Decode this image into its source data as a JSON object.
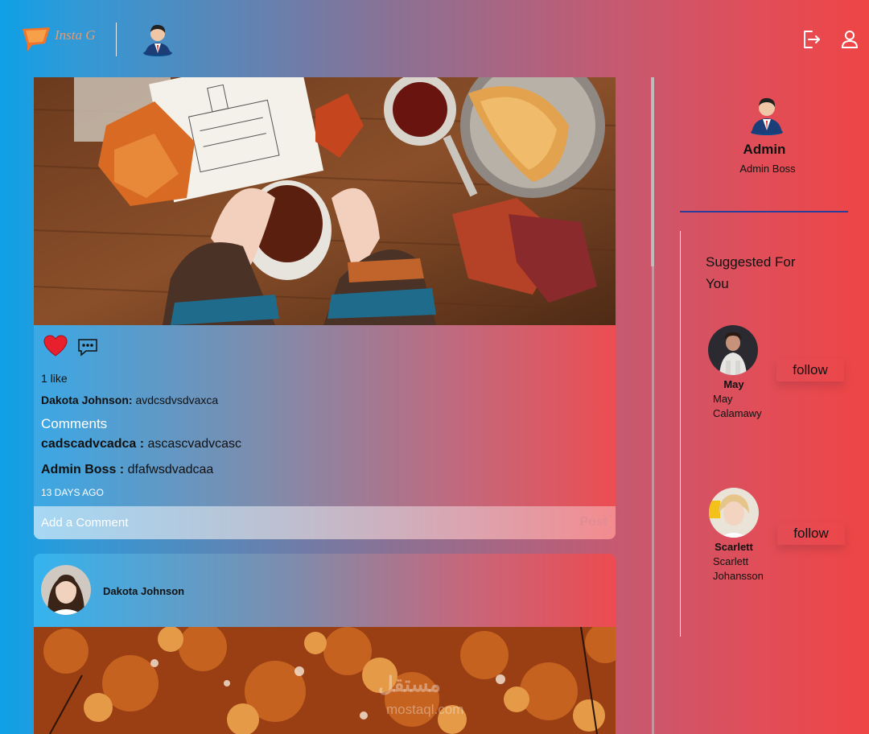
{
  "app": {
    "logo_text": "Insta G",
    "logo_tagline": "· · · · · · · · · ·"
  },
  "feed": {
    "post1": {
      "likes": "1 like",
      "author": "Dakota Johnson:",
      "caption": "avdcsdvsdvaxca",
      "comments_heading": "Comments",
      "comments": [
        {
          "user": "cadscadvcadca :",
          "text": "ascascvadvcasc"
        },
        {
          "user": "Admin Boss :",
          "text": "dfafwsdvadcaa"
        }
      ],
      "timestamp": "13 DAYS AGO",
      "add_comment_placeholder": "Add a Comment",
      "post_label": "Post"
    },
    "post2": {
      "author": "Dakota Johnson"
    }
  },
  "watermark": {
    "arabic": "مستقل",
    "latin": "mostaql.com"
  },
  "sidebar": {
    "profile": {
      "name": "Admin",
      "handle": "Admin Boss"
    },
    "suggested_title": "Suggested For You",
    "suggestions": [
      {
        "username": "May",
        "full_name": "May Calamawy",
        "follow_label": "follow"
      },
      {
        "username": "Scarlett",
        "full_name": "Scarlett Johansson",
        "follow_label": "follow"
      }
    ]
  },
  "icons": {
    "logout": "logout-icon",
    "profile": "user-icon",
    "like": "heart-icon",
    "comment": "comment-icon"
  },
  "colors": {
    "heart": "#e8202e",
    "divider": "#2a3d9a",
    "post_label": "#e28c94"
  }
}
